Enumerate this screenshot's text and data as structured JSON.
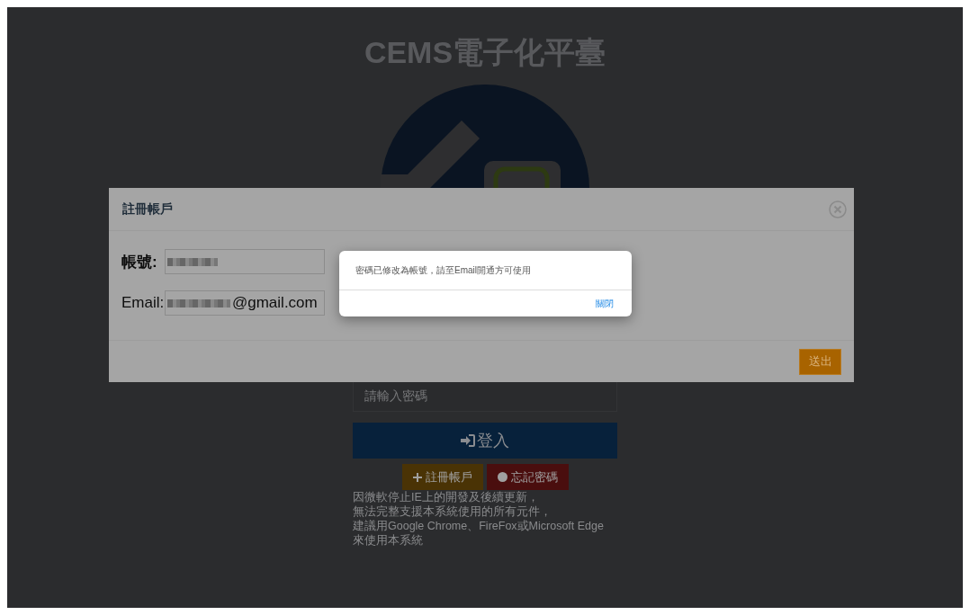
{
  "page": {
    "title": "CEMS電子化平臺",
    "password": {
      "placeholder": "請輸入密碼"
    },
    "login_button": "登入",
    "register_button": "註冊帳戶",
    "forgot_button": "忘記密碼",
    "notice": [
      "因微軟停止IE上的開發及後續更新，",
      "無法完整支援本系統使用的所有元件，",
      "建議用Google Chrome、FireFox或Microsoft Edge",
      "來使用本系統"
    ]
  },
  "modal": {
    "title": "註冊帳戶",
    "fields": [
      {
        "label": "帳號:"
      },
      {
        "label": "Email:",
        "value": "@gmail.com"
      }
    ],
    "submit": "送出"
  },
  "alert": {
    "message": "密碼已修改為帳號，請至Email開通方可使用",
    "close": "關閉"
  }
}
